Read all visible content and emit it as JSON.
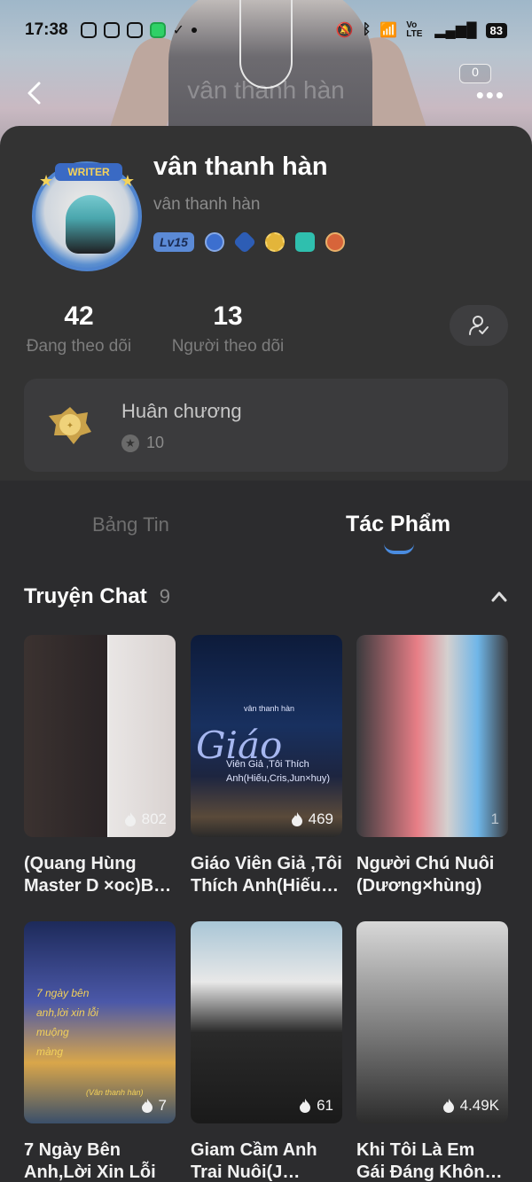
{
  "status": {
    "time": "17:38",
    "network": "Vo LTE",
    "battery": "83"
  },
  "header": {
    "title": "vân thanh hàn",
    "badge_count": "0",
    "more": "•••"
  },
  "profile": {
    "name": "vân thanh hàn",
    "username": "vân thanh hàn",
    "avatar_frame_label": "WRITER",
    "level": "Lv15",
    "stats": [
      {
        "value": "42",
        "label": "Đang theo dõi"
      },
      {
        "value": "13",
        "label": "Người theo dõi"
      }
    ],
    "medals": {
      "title": "Huân chương",
      "count": "10"
    }
  },
  "tabs": [
    {
      "label": "Bảng Tin",
      "active": false
    },
    {
      "label": "Tác Phẩm",
      "active": true
    }
  ],
  "section": {
    "title": "Truyện Chat",
    "count": "9"
  },
  "stories": [
    {
      "title": "(Quang Hùng Master D ×oc)B…",
      "views": "802"
    },
    {
      "title": "Giáo Viên Giả ,Tôi Thích Anh(Hiếu…",
      "views": "469",
      "cover_text": "Giáo",
      "cover_small": "vân thanh hàn",
      "cover_sub": "Viên Giả ,Tôi Thích Anh(Hiếu,Cris,Jun×huy)"
    },
    {
      "title": "Người Chú Nuôi (Dương×hùng)",
      "views": "1"
    },
    {
      "title": "7 Ngày Bên Anh,Lời Xin Lỗi …",
      "views": "7",
      "cover_text": "7 ngày bên anh,lời xin lỗi muộng màng",
      "cover_small": "(Vân thanh hàn)"
    },
    {
      "title": "Giam Cầm Anh Trai Nuôi(J…",
      "views": "61"
    },
    {
      "title": "Khi Tôi Là Em Gái Đáng Khôn…",
      "views": "4.49K"
    }
  ],
  "colors": {
    "accent": "#4a8ce0",
    "card_bg": "#333333",
    "page_bg": "#2c2c2e"
  }
}
